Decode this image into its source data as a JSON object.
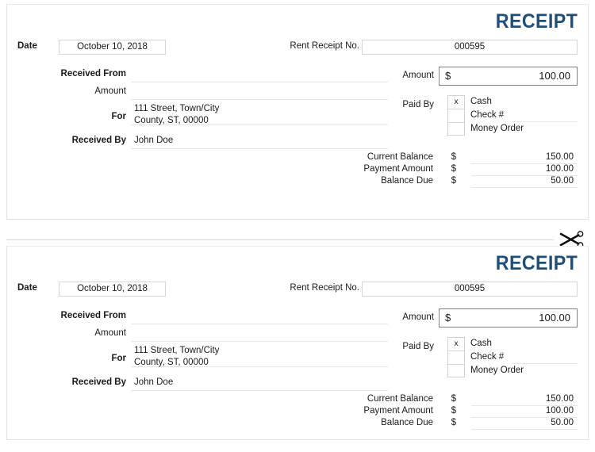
{
  "document": {
    "type": "rent-receipt-template",
    "copies": 2
  },
  "receipt": {
    "title": "RECEIPT",
    "title_color": "#1f4e79",
    "date_label": "Date",
    "date_value": "October 10, 2018",
    "receipt_no_label": "Rent Receipt No.",
    "receipt_no_value": "000595",
    "fields": [
      {
        "label": "Received From",
        "value": "",
        "bold": true
      },
      {
        "label": "Amount",
        "value": "",
        "bold": false
      },
      {
        "label": "For",
        "value": "",
        "bold": true
      },
      {
        "label": "Received By",
        "value": "John Doe",
        "bold": true
      }
    ],
    "address": {
      "line1": "111 Street, Town/City",
      "line2": "County, ST, 00000"
    },
    "amount": {
      "label": "Amount",
      "currency": "$",
      "value": "100.00"
    },
    "paid_by": {
      "label": "Paid By",
      "options": [
        {
          "name": "Cash",
          "checked": true,
          "mark": "x"
        },
        {
          "name": "Check #",
          "checked": false,
          "mark": ""
        },
        {
          "name": "Money Order",
          "checked": false,
          "mark": ""
        }
      ]
    },
    "totals": [
      {
        "label": "Current Balance",
        "currency": "$",
        "value": "150.00"
      },
      {
        "label": "Payment Amount",
        "currency": "$",
        "value": "100.00"
      },
      {
        "label": "Balance Due",
        "currency": "$",
        "value": "50.00"
      }
    ]
  },
  "divider": {
    "icon": "scissors-icon"
  }
}
